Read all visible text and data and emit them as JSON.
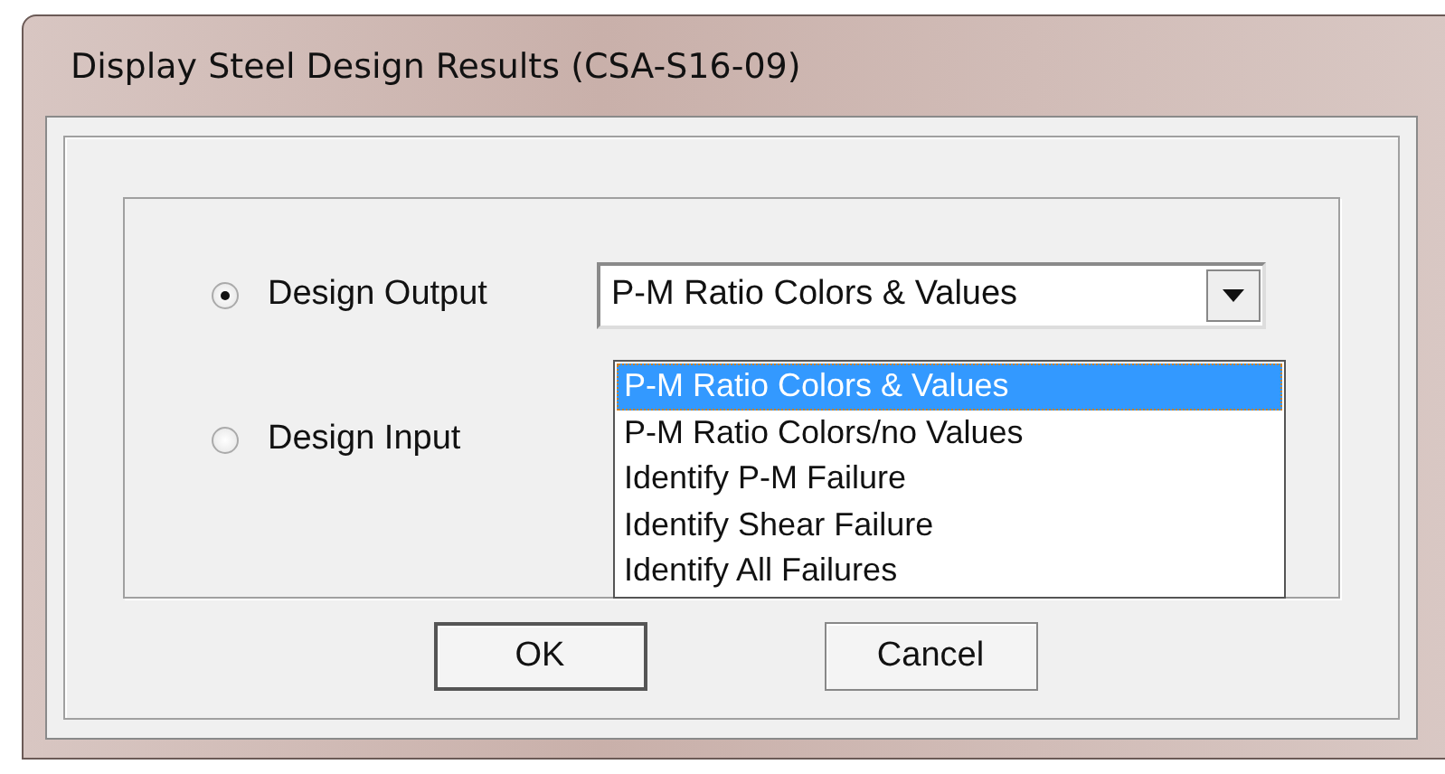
{
  "window": {
    "title": "Display Steel Design Results (CSA-S16-09)"
  },
  "options": [
    {
      "label": "Design Output",
      "selected": true
    },
    {
      "label": "Design Input",
      "selected": false
    }
  ],
  "dropdown": {
    "value": "P-M Ratio Colors & Values",
    "expanded": true,
    "items": [
      {
        "label": "P-M Ratio Colors & Values",
        "selected": true
      },
      {
        "label": "P-M Ratio Colors/no Values",
        "selected": false
      },
      {
        "label": "Identify P-M Failure",
        "selected": false
      },
      {
        "label": "Identify Shear Failure",
        "selected": false
      },
      {
        "label": "Identify All Failures",
        "selected": false
      }
    ]
  },
  "buttons": [
    {
      "label": "OK",
      "default": true
    },
    {
      "label": "Cancel",
      "default": false
    }
  ]
}
